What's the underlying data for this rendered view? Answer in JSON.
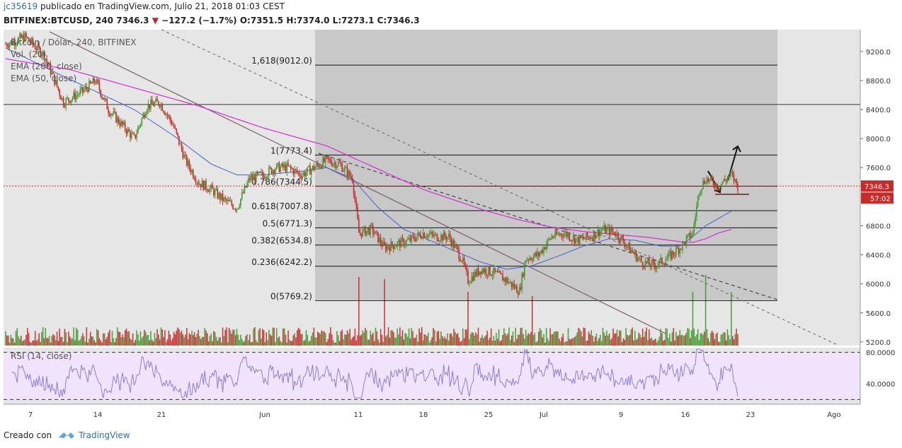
{
  "header": {
    "user": "jc35619",
    "published": "publicado en TradingView.com, Julio 21, 2018 01:03 CEST",
    "symbol": "BITFINEX:BTCUSD, 240",
    "last": "7346.3",
    "change": "−127.2 (−1.7%)",
    "o": "O:7351.5",
    "h": "H:7374.0",
    "l": "L:7273.1",
    "c": "C:7346.3"
  },
  "legend": {
    "title": "Bitcoin / Dólar, 240, BITFINEX",
    "vol": "Vol. (20)",
    "ema200": "EMA (200, close)",
    "ema50": "EMA (50, close)",
    "rsi": "RSI (14, close)"
  },
  "footer": {
    "created": "Creado con",
    "brand": "TradingView"
  },
  "colors": {
    "up": "#3e9b2f",
    "down": "#c82a2a",
    "ema200": "#d62cd6",
    "ema50": "#4a5ec4",
    "rsi": "#8a80d0",
    "rsi_band": "#f1e3fb",
    "fib_zone": "#c8c8c8",
    "bg": "#e6e6e6"
  },
  "chart_data": [
    {
      "type": "candlestick",
      "title": "Bitcoin / Dólar, 240, BITFINEX",
      "ylim": [
        5150,
        9500
      ],
      "x_ticks": [
        "7",
        "14",
        "21",
        "Jun",
        "11",
        "18",
        "25",
        "Jul",
        "9",
        "16",
        "23",
        "Ago"
      ],
      "y_ticks": [
        "9200.0",
        "8800.0",
        "8400.0",
        "8000.0",
        "7600.0",
        "6800.0",
        "6400.0",
        "6000.0",
        "5600.0",
        "5200.0"
      ],
      "price_label": "7346.3",
      "countdown_label": "57:02",
      "price_path": [
        [
          0,
          9300
        ],
        [
          3,
          9400
        ],
        [
          6,
          9150
        ],
        [
          9,
          8500
        ],
        [
          12,
          8650
        ],
        [
          14,
          8800
        ],
        [
          16,
          8400
        ],
        [
          18,
          8200
        ],
        [
          20,
          8000
        ],
        [
          22,
          8450
        ],
        [
          24,
          8500
        ],
        [
          26,
          8200
        ],
        [
          28,
          7700
        ],
        [
          30,
          7400
        ],
        [
          32,
          7300
        ],
        [
          34,
          7150
        ],
        [
          36,
          7050
        ],
        [
          38,
          7450
        ],
        [
          40,
          7500
        ],
        [
          42,
          7600
        ],
        [
          44,
          7600
        ],
        [
          46,
          7500
        ],
        [
          48,
          7600
        ],
        [
          50,
          7700
        ],
        [
          52,
          7650
        ],
        [
          54,
          7450
        ],
        [
          55,
          6700
        ],
        [
          57,
          6750
        ],
        [
          59,
          6500
        ],
        [
          61,
          6550
        ],
        [
          63,
          6600
        ],
        [
          65,
          6700
        ],
        [
          67,
          6650
        ],
        [
          69,
          6650
        ],
        [
          71,
          6350
        ],
        [
          72,
          6050
        ],
        [
          74,
          6200
        ],
        [
          76,
          6150
        ],
        [
          78,
          6050
        ],
        [
          80,
          5900
        ],
        [
          81,
          6350
        ],
        [
          83,
          6400
        ],
        [
          85,
          6650
        ],
        [
          87,
          6700
        ],
        [
          89,
          6600
        ],
        [
          91,
          6650
        ],
        [
          93,
          6750
        ],
        [
          95,
          6700
        ],
        [
          97,
          6500
        ],
        [
          99,
          6300
        ],
        [
          101,
          6250
        ],
        [
          103,
          6350
        ],
        [
          105,
          6500
        ],
        [
          107,
          6700
        ],
        [
          108,
          7300
        ],
        [
          109,
          7450
        ],
        [
          111,
          7350
        ],
        [
          113,
          7500
        ],
        [
          114,
          7346
        ]
      ],
      "ema200_path": [
        [
          0,
          9100
        ],
        [
          10,
          8950
        ],
        [
          20,
          8700
        ],
        [
          30,
          8450
        ],
        [
          40,
          8150
        ],
        [
          50,
          7900
        ],
        [
          55,
          7700
        ],
        [
          60,
          7500
        ],
        [
          65,
          7300
        ],
        [
          70,
          7150
        ],
        [
          75,
          7000
        ],
        [
          80,
          6880
        ],
        [
          85,
          6780
        ],
        [
          90,
          6720
        ],
        [
          95,
          6680
        ],
        [
          100,
          6640
        ],
        [
          105,
          6580
        ],
        [
          107,
          6570
        ],
        [
          109,
          6620
        ],
        [
          111,
          6700
        ],
        [
          113,
          6750
        ]
      ],
      "ema50_path": [
        [
          0,
          9250
        ],
        [
          8,
          8900
        ],
        [
          14,
          8650
        ],
        [
          20,
          8400
        ],
        [
          26,
          8050
        ],
        [
          32,
          7650
        ],
        [
          36,
          7500
        ],
        [
          40,
          7500
        ],
        [
          46,
          7550
        ],
        [
          50,
          7600
        ],
        [
          54,
          7450
        ],
        [
          58,
          7050
        ],
        [
          62,
          6750
        ],
        [
          66,
          6600
        ],
        [
          70,
          6450
        ],
        [
          74,
          6300
        ],
        [
          78,
          6200
        ],
        [
          82,
          6250
        ],
        [
          86,
          6380
        ],
        [
          90,
          6520
        ],
        [
          94,
          6620
        ],
        [
          98,
          6600
        ],
        [
          102,
          6520
        ],
        [
          105,
          6520
        ],
        [
          107,
          6650
        ],
        [
          109,
          6800
        ],
        [
          111,
          6900
        ],
        [
          113,
          7000
        ]
      ],
      "volume_spikes": [
        [
          55,
          0.95
        ],
        [
          59,
          0.9
        ],
        [
          72,
          0.6
        ],
        [
          82,
          0.5
        ],
        [
          107,
          0.6
        ],
        [
          109,
          1.0
        ],
        [
          113,
          0.6
        ]
      ],
      "fibonacci": [
        {
          "label": "1,618(9012.0)",
          "value": 9012.0
        },
        {
          "label": "1(7773.4)",
          "value": 7773.4
        },
        {
          "label": "0.786(7344.5)",
          "value": 7344.5
        },
        {
          "label": "0.618(7007.8)",
          "value": 7007.8
        },
        {
          "label": "0.5(6771.3)",
          "value": 6771.3
        },
        {
          "label": "0.382(6534.8)",
          "value": 6534.8
        },
        {
          "label": "0.236(6242.2)",
          "value": 6242.2
        },
        {
          "label": "0(5769.2)",
          "value": 5769.2
        }
      ],
      "hline": 8470
    },
    {
      "type": "line",
      "title": "RSI (14, close)",
      "ylim": [
        14,
        86
      ],
      "bands": [
        80,
        20
      ],
      "y_ticks": [
        "80.0000",
        "40.0000"
      ]
    }
  ]
}
